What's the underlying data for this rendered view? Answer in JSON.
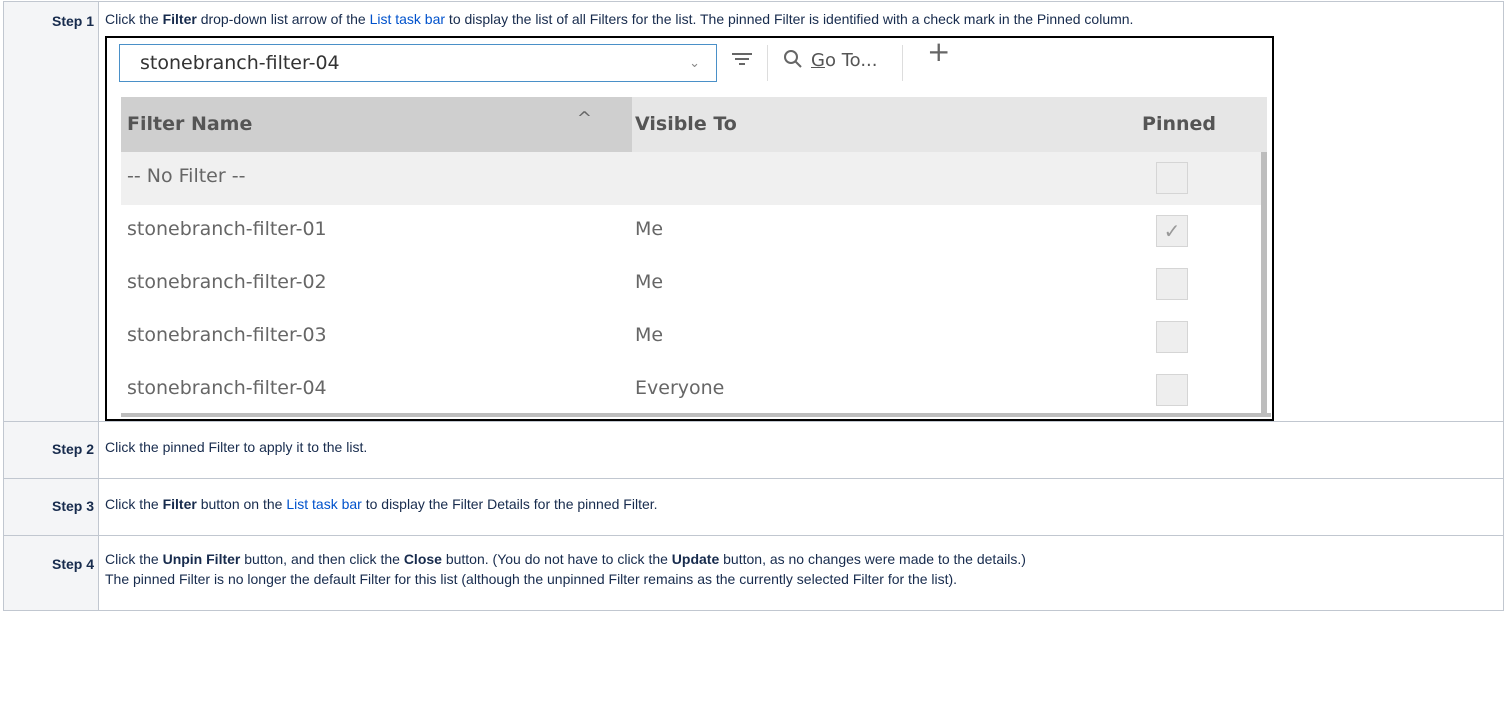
{
  "steps": [
    {
      "label": "Step 1",
      "parts": [
        "Click the ",
        "Filter",
        " drop-down list arrow of the ",
        "List task bar",
        " to display the list of all Filters for the list. The pinned Filter is identified with a check mark in the Pinned column."
      ]
    },
    {
      "label": "Step 2",
      "text": "Click the pinned Filter to apply it to the list."
    },
    {
      "label": "Step 3",
      "parts": [
        "Click the ",
        "Filter",
        " button on the ",
        "List task bar",
        " to display the Filter Details for the pinned Filter."
      ]
    },
    {
      "label": "Step 4",
      "parts": [
        "Click the ",
        "Unpin Filter",
        " button, and then click the ",
        "Close",
        " button. (You do not have to click the ",
        "Update",
        " button, as no changes were made to the details.)"
      ],
      "line2": "The pinned Filter is no longer the default Filter for this list (although the unpinned Filter remains as the currently selected Filter for the list)."
    }
  ],
  "screenshot": {
    "combo_value": "stonebranch-filter-04",
    "combo_arrow": "⌄",
    "filter_icon": "filter-lines-icon",
    "search_icon": "magnifier-icon",
    "goto_hotkey": "G",
    "goto_rest": "o To...",
    "add_icon": "+",
    "headers": {
      "name": "Filter Name",
      "visible_to": "Visible To",
      "pinned": "Pinned"
    },
    "rows": [
      {
        "name": "-- No Filter --",
        "visible_to": "",
        "pinned": false
      },
      {
        "name": "stonebranch-filter-01",
        "visible_to": "Me",
        "pinned": true
      },
      {
        "name": "stonebranch-filter-02",
        "visible_to": "Me",
        "pinned": false
      },
      {
        "name": "stonebranch-filter-03",
        "visible_to": "Me",
        "pinned": false
      },
      {
        "name": "stonebranch-filter-04",
        "visible_to": "Everyone",
        "pinned": false
      }
    ],
    "check_glyph": "✓"
  }
}
